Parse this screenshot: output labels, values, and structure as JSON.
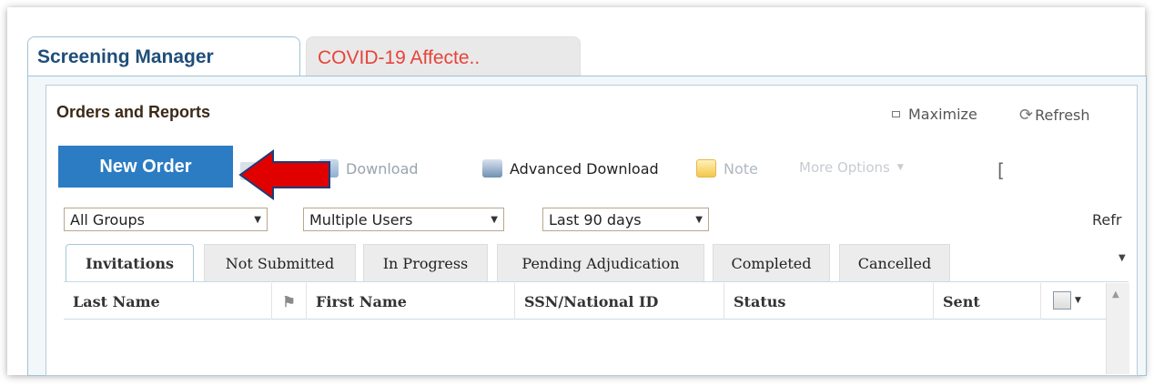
{
  "tabs": {
    "screening": "Screening Manager",
    "covid": "COVID-19 Affecte.."
  },
  "panel": {
    "title": "Orders and Reports",
    "maximize": "Maximize",
    "refresh": "Refresh"
  },
  "toolbar": {
    "new_order": "New Order",
    "download": "Download",
    "advanced_download": "Advanced Download",
    "note": "Note",
    "more_options": "More Options",
    "bracket": "["
  },
  "filters": {
    "groups": "All Groups",
    "users": "Multiple Users",
    "period": "Last 90 days",
    "refresh_partial": "Refr"
  },
  "subtabs": [
    "Invitations",
    "Not Submitted",
    "In Progress",
    "Pending Adjudication",
    "Completed",
    "Cancelled"
  ],
  "columns": [
    "Last Name",
    "First Name",
    "SSN/National ID",
    "Status",
    "Sent"
  ],
  "icons": {
    "maximize": "maximize-icon",
    "refresh": "refresh-icon",
    "download": "download-icon",
    "advanced_download": "advanced-download-icon",
    "note": "note-icon",
    "flag": "flag-icon",
    "grid_settings": "grid-settings-icon",
    "annotation_arrow": "red-arrow-icon"
  },
  "colors": {
    "primary_button": "#2b7cc2",
    "tab_title": "#1f4e79",
    "covid_tab": "#e6443a",
    "arrow": "#e00000"
  }
}
